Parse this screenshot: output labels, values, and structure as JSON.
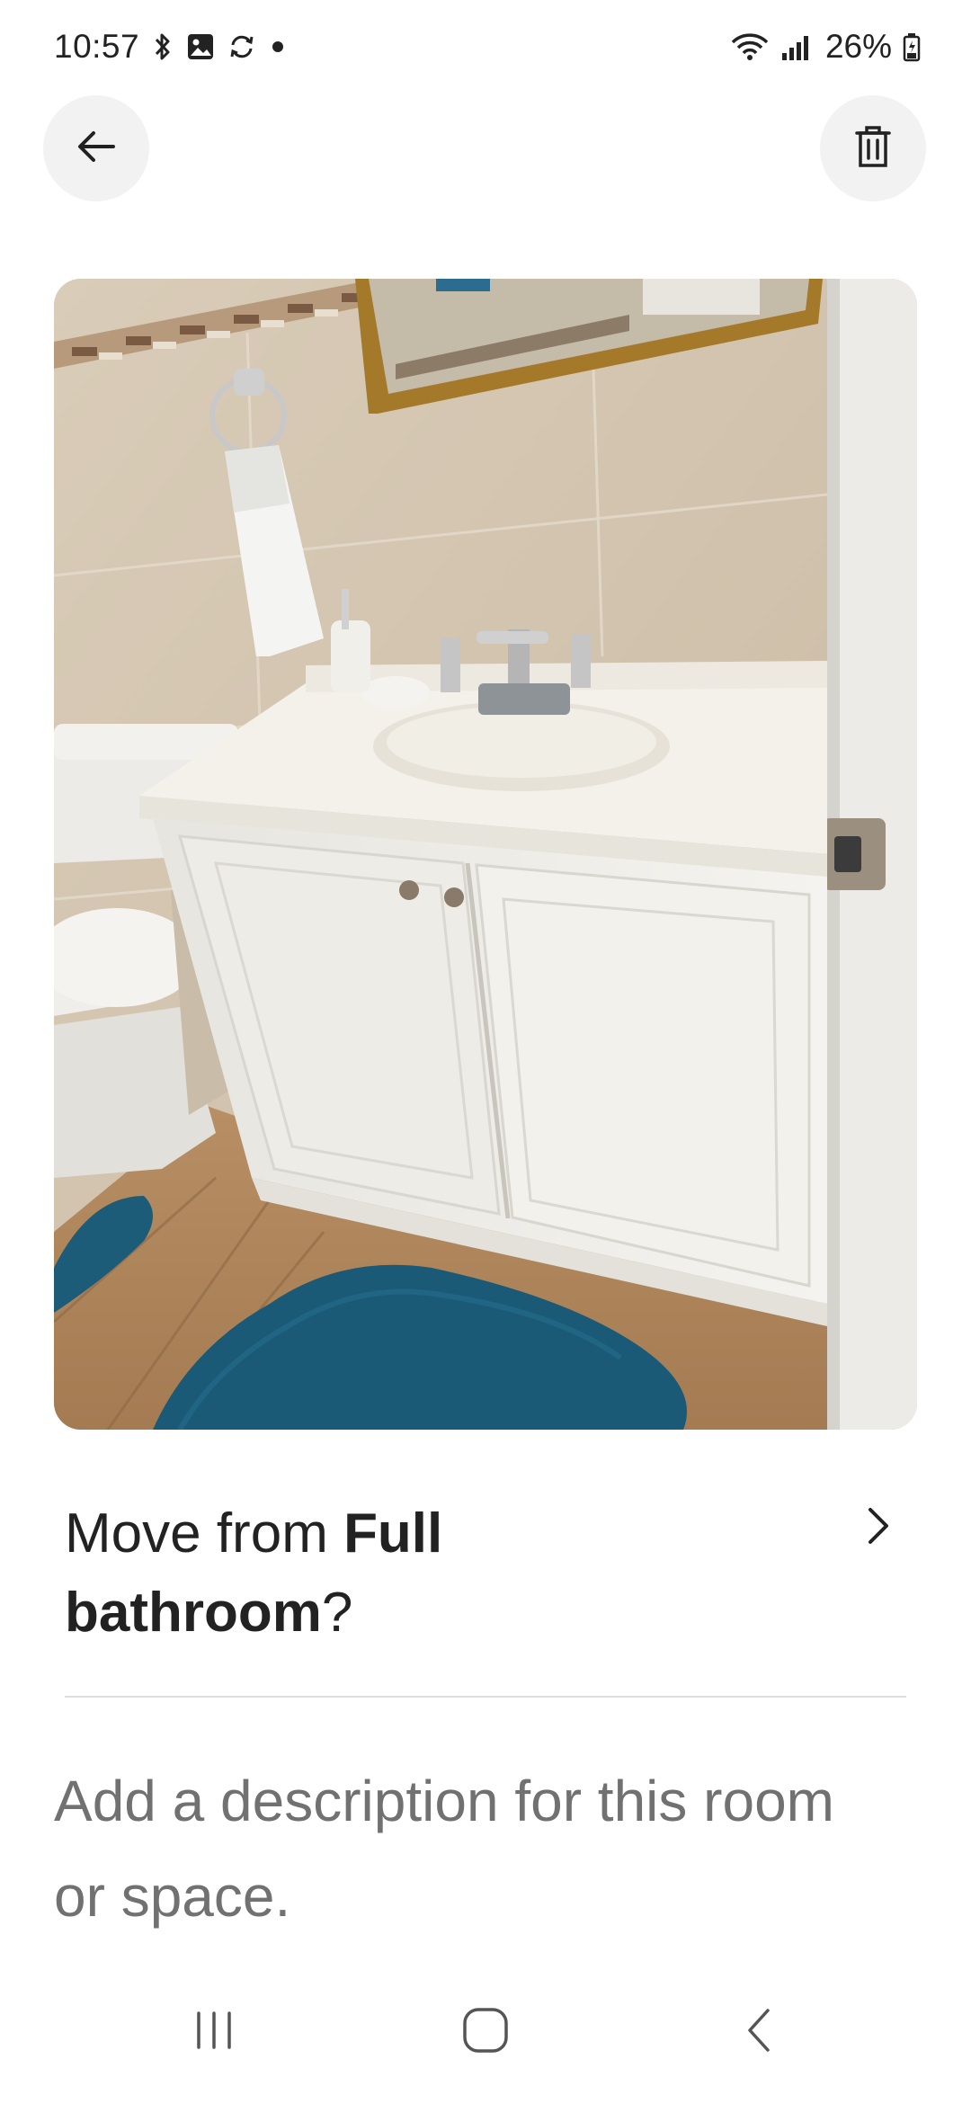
{
  "status_bar": {
    "time": "10:57",
    "battery": "26%",
    "icons": [
      "bluetooth-icon",
      "gallery-icon",
      "sync-icon",
      "dot-icon",
      "wifi-icon",
      "signal-icon",
      "battery-icon"
    ]
  },
  "header": {
    "back_icon": "arrow-left-icon",
    "delete_icon": "trash-icon"
  },
  "photo": {
    "subject": "bathroom vanity photo"
  },
  "move": {
    "prefix": "Move from ",
    "room": "Full bathroom",
    "suffix": "?",
    "chevron_icon": "chevron-right-icon"
  },
  "description": {
    "value": "",
    "placeholder": "Add a description for this room or space."
  },
  "nav_bar": {
    "icons": [
      "recent-apps-icon",
      "home-icon",
      "back-icon"
    ]
  },
  "colors": {
    "text": "#222222",
    "placeholder": "#717171",
    "button_bg": "#f2f2f2",
    "divider": "#dddddd"
  }
}
